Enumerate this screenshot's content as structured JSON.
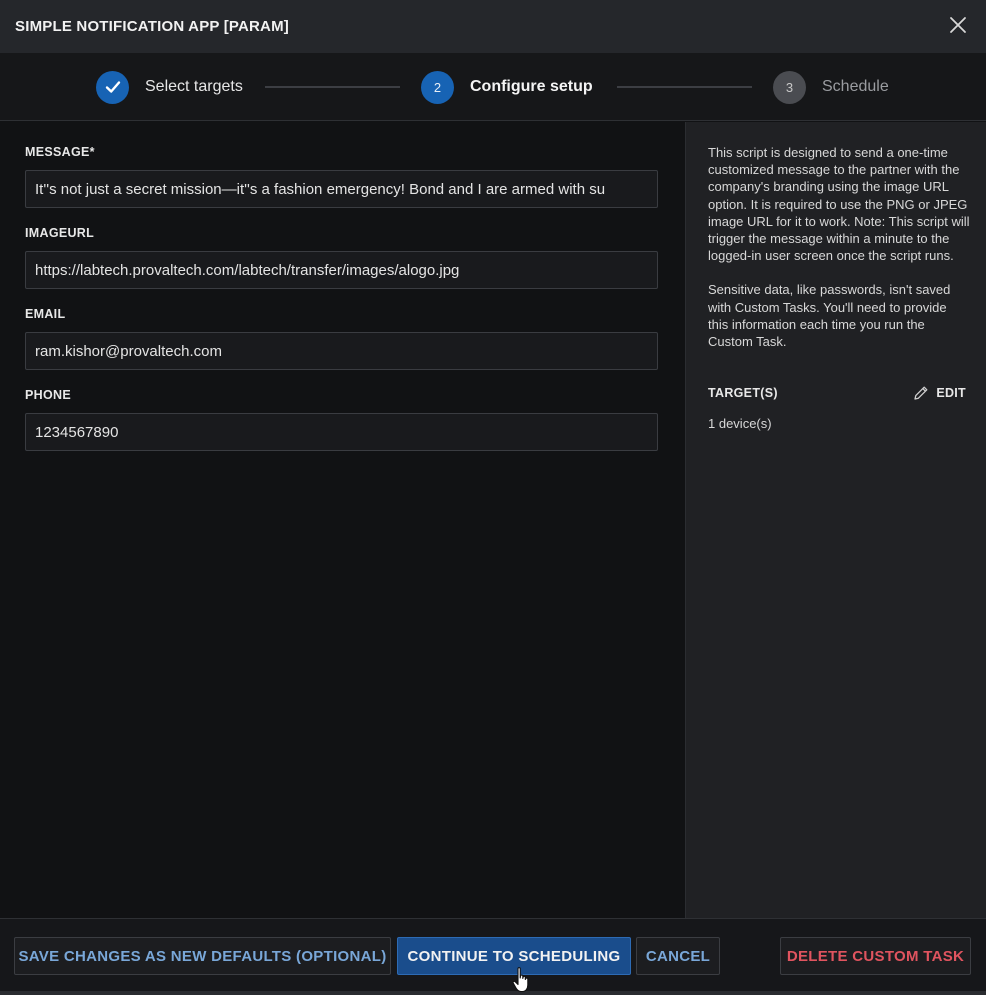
{
  "dialog": {
    "title": "SIMPLE NOTIFICATION APP [PARAM]",
    "close_icon": "close-icon"
  },
  "stepper": {
    "steps": [
      {
        "number": "",
        "label": "Select targets",
        "state": "completed",
        "icon": "checkmark-icon"
      },
      {
        "number": "2",
        "label": "Configure setup",
        "state": "active"
      },
      {
        "number": "3",
        "label": "Schedule",
        "state": "pending"
      }
    ],
    "colors": {
      "active": "#1763b4",
      "pending": "#4a4c51"
    }
  },
  "form": {
    "message": {
      "label": "MESSAGE*",
      "value": "It''s not just a secret mission—it''s a fashion emergency! Bond and I are armed with su"
    },
    "imageurl": {
      "label": "IMAGEURL",
      "value": "https://labtech.provaltech.com/labtech/transfer/images/alogo.jpg"
    },
    "email": {
      "label": "EMAIL",
      "value": "ram.kishor@provaltech.com"
    },
    "phone": {
      "label": "PHONE",
      "value": "1234567890"
    }
  },
  "side_panel": {
    "description": "This script is designed to send a one-time customized message to the partner with the company's branding using the image URL option. It is required to use the PNG or JPEG image URL for it to work. Note: This script will trigger the message within a minute to the logged-in user screen once the script runs.",
    "sensitive_note": "Sensitive data, like passwords, isn't saved with Custom Tasks. You'll need to provide this information each time you run the Custom Task.",
    "targets_label": "TARGET(S)",
    "edit_label": "EDIT",
    "edit_icon": "pencil-icon",
    "device_count": "1 device(s)"
  },
  "footer": {
    "save_defaults_label": "SAVE CHANGES AS NEW DEFAULTS (OPTIONAL)",
    "continue_label": "CONTINUE TO SCHEDULING",
    "cancel_label": "CANCEL",
    "delete_label": "DELETE CUSTOM TASK",
    "colors": {
      "primary": "#1a4d8c",
      "link": "#79a7d8",
      "danger": "#e0545f"
    }
  }
}
